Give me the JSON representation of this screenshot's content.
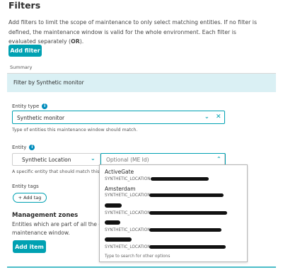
{
  "page": {
    "title": "Filters",
    "description_lines": [
      "Add filters to limit the scope of maintenance to only select matching entities. If no filter is",
      "defined, the maintenance window is valid for the whole environment. Each filter is",
      "evaluated separately ("
    ],
    "description_or": "OR",
    "description_end": ").",
    "add_filter_label": "Add filter",
    "summary_label": "Summary",
    "filter_row_label": "Filter by Synthetic monitor"
  },
  "entity_type": {
    "label": "Entity type",
    "value": "Synthetic monitor",
    "hint": "Type of entities this maintenance window should match."
  },
  "entity": {
    "label": "Entity",
    "type_value": "Synthetic Location",
    "id_placeholder": "Optional (ME Id)",
    "hint": "A specific entity that should match this mai"
  },
  "entity_tags": {
    "label": "Entity tags",
    "add_tag_label": "+ Add tag"
  },
  "management_zones": {
    "title": "Management zones",
    "desc_line1": "Entities which are part of all the confi",
    "desc_line2": "maintenance window.",
    "add_item_label": "Add item"
  },
  "dropdown": {
    "options": [
      {
        "name": "ActiveGate",
        "id": "SYNTHETIC_LOCATION-"
      },
      {
        "name": "Amsterdam",
        "id": "SYNTHETIC_LOCATION-"
      },
      {
        "name": "",
        "id": "SYNTHETIC_LOCATION-"
      },
      {
        "name": "",
        "id": "SYNTHETIC_LOCATION-"
      },
      {
        "name": "",
        "id": "SYNTHETIC_LOCATION-"
      }
    ],
    "footer": "Type to search for other options"
  },
  "colors": {
    "accent": "#00a1b2",
    "row_highlight": "#daf0f4",
    "info": "#008cbc"
  },
  "icons": [
    "info-icon",
    "chevron-down-icon",
    "chevron-up-icon",
    "close-icon"
  ]
}
